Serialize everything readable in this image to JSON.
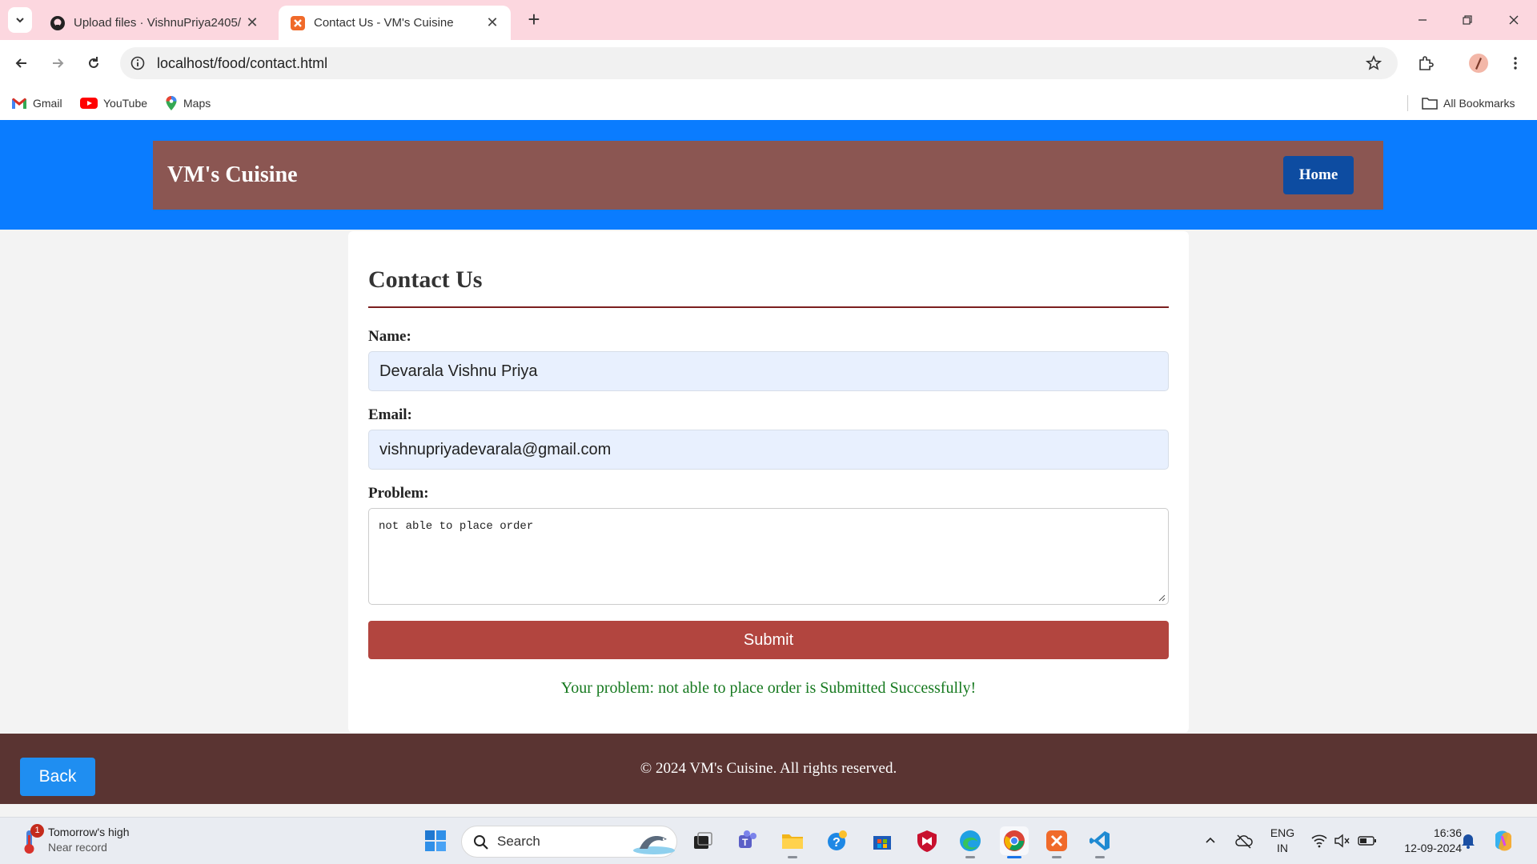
{
  "browser": {
    "tabs": [
      {
        "title": "Upload files · VishnuPriya2405/",
        "active": false
      },
      {
        "title": "Contact Us - VM's Cuisine",
        "active": true
      }
    ],
    "url": "localhost/food/contact.html",
    "bookmarks": [
      "Gmail",
      "YouTube",
      "Maps"
    ],
    "all_bookmarks": "All Bookmarks"
  },
  "site": {
    "title": "VM's Cuisine",
    "home_label": "Home"
  },
  "form": {
    "heading": "Contact Us",
    "name_label": "Name:",
    "name_value": "Devarala Vishnu Priya",
    "email_label": "Email:",
    "email_value": "vishnupriyadevarala@gmail.com",
    "problem_label": "Problem:",
    "problem_value": "not able to place order",
    "submit_label": "Submit",
    "success_message": "Your problem: not able to place order is Submitted Successfully!"
  },
  "footer": {
    "copyright": "© 2024 VM's Cuisine. All rights reserved.",
    "back_label": "Back"
  },
  "taskbar": {
    "weather_title": "Tomorrow's high",
    "weather_sub": "Near record",
    "weather_badge": "1",
    "search_placeholder": "Search",
    "lang_line1": "ENG",
    "lang_line2": "IN",
    "time": "16:36",
    "date": "12-09-2024"
  },
  "colors": {
    "header_blue": "#0a7cff",
    "header_bar": "#8b5652",
    "home_button": "#0d4ca1",
    "submit_button": "#b2453f",
    "success_text": "#16791f",
    "footer": "#5a3432",
    "back_button": "#1f8ef1"
  }
}
